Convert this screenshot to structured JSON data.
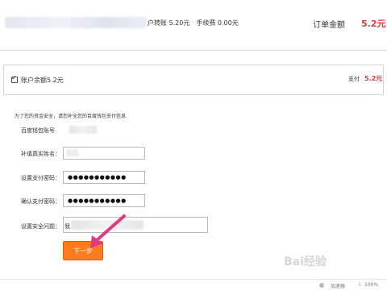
{
  "order": {
    "description": "户转账 5.20元　手续费 0.00元",
    "total_label": "订单金额",
    "total_value": "5.2元"
  },
  "balance": {
    "checkmark": "✓",
    "label": "账户余额5.2元",
    "pay_label": "支付",
    "pay_value": "5.2元"
  },
  "form": {
    "notice": "为了您的资金安全，请您补全您的百度钱包支付信息",
    "account_label": "百度钱包账号",
    "real_name_label": "补填真实姓名：",
    "pay_password_label": "设置支付密码：",
    "pay_password_value": "●●●●●●●●●●●",
    "confirm_password_label": "确认支付密码：",
    "confirm_password_value": "●●●●●●●●●●●",
    "security_question_label": "设置安全问题：",
    "security_question_prefix": "我",
    "next_button": "下一步"
  },
  "footer": {
    "text": "加速器",
    "icon": "⇩",
    "zoom": "100%"
  },
  "watermark": "Bai经验",
  "colors": {
    "accent_orange": "#ff7b1c",
    "price_red": "#e4393c",
    "arrow_pink": "#e23a7e"
  }
}
